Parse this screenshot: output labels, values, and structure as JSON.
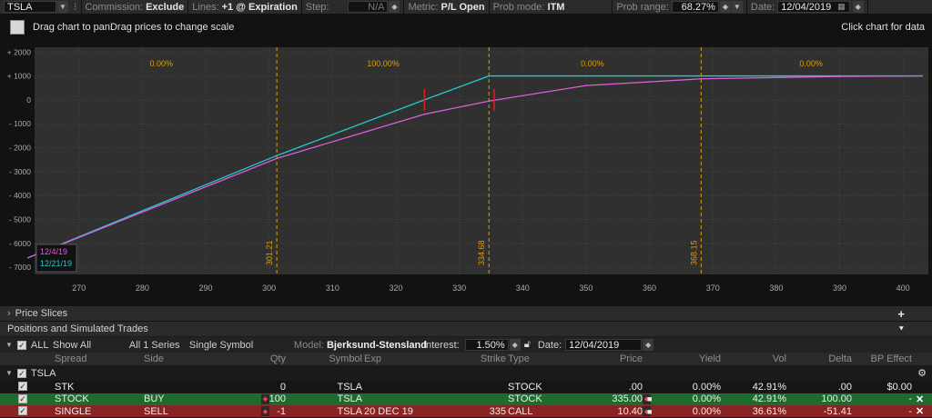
{
  "toolbar": {
    "symbol": "TSLA",
    "commission_label": "Commission:",
    "commission_value": "Exclude",
    "lines_label": "Lines:",
    "lines_value": "+1 @ Expiration",
    "step_label": "Step:",
    "step_value": "N/A",
    "metric_label": "Metric:",
    "metric_value": "P/L Open",
    "prob_mode_label": "Prob mode:",
    "prob_mode_value": "ITM",
    "prob_range_label": "Prob range:",
    "prob_range_value": "68.27%",
    "date_label": "Date:",
    "date_value": "12/04/2019"
  },
  "titlebar": {
    "hint": "Drag chart to panDrag prices to change scale",
    "click_hint": "Click chart for data"
  },
  "chart_data": {
    "type": "line",
    "x": [
      262,
      301.21,
      324.5,
      334.68,
      350,
      368.15,
      390,
      403
    ],
    "series": [
      {
        "name": "12/21/19",
        "color": "#22cccc",
        "values": [
          -6600,
          -2330,
          0,
          1000,
          1000,
          1000,
          1000,
          1000
        ]
      },
      {
        "name": "12/4/19",
        "color": "#d95fd9",
        "values": [
          -6600,
          -2450,
          -600,
          -51,
          600,
          880,
          980,
          1000
        ]
      }
    ],
    "xlim": [
      263,
      404
    ],
    "ylim": [
      -7300,
      2200
    ],
    "x_ticks": [
      270,
      280,
      290,
      300,
      310,
      320,
      330,
      340,
      350,
      360,
      370,
      380,
      390,
      400
    ],
    "y_ticks": [
      2000,
      1000,
      0,
      -1000,
      -2000,
      -3000,
      -4000,
      -5000,
      -6000,
      -7000
    ],
    "y_tick_labels": [
      "+ 2000",
      "+ 1000",
      "0",
      "- 1000",
      "- 2000",
      "- 3000",
      "- 4000",
      "- 5000",
      "- 6000",
      "- 7000"
    ],
    "vlines": [
      {
        "x": 301.21,
        "label": "301.21"
      },
      {
        "x": 334.68,
        "label": "334.68"
      },
      {
        "x": 368.15,
        "label": "368.15"
      }
    ],
    "zone_labels": [
      {
        "x": 283,
        "text": "0.00%"
      },
      {
        "x": 318,
        "text": "100.00%"
      },
      {
        "x": 351,
        "text": "0.00%"
      },
      {
        "x": 385.5,
        "text": "0.00%"
      }
    ],
    "markers": [
      {
        "x": 324.5,
        "y": 0
      },
      {
        "x": 335.5,
        "y": 0
      }
    ],
    "legend": [
      "12/4/19",
      "12/21/19"
    ],
    "grid": true
  },
  "sections": {
    "price_slices": "Price Slices",
    "positions": "Positions and Simulated Trades"
  },
  "filter": {
    "all": "ALL",
    "show_all": "Show All",
    "series": "All 1 Series",
    "single_symbol": "Single Symbol",
    "model_label": "Model:",
    "model_value": "Bjerksund-Stensland",
    "interest_label": "Interest:",
    "interest_value": "1.50%",
    "date_label": "Date:",
    "date_value": "12/04/2019"
  },
  "columns": [
    "Spread",
    "Side",
    "Qty",
    "Symbol",
    "Exp",
    "Strike",
    "Type",
    "Price",
    "Yield",
    "Vol",
    "Delta",
    "BP Effect"
  ],
  "group": {
    "label": "TSLA"
  },
  "rows": [
    {
      "spread": "STK",
      "side": "",
      "qty": "0",
      "symbol": "TSLA",
      "exp": "",
      "strike": "",
      "type": "STOCK",
      "price": ".00",
      "yield": "0.00%",
      "vol": "42.91%",
      "delta": ".00",
      "bp": "$0.00",
      "bg": "#151515"
    },
    {
      "spread": "STOCK",
      "side": "BUY",
      "qty": "+100",
      "symbol": "TSLA",
      "exp": "",
      "strike": "",
      "type": "STOCK",
      "price": "335.00",
      "yield": "0.00%",
      "vol": "42.91%",
      "delta": "100.00",
      "bp": "-",
      "bg": "#1f6b2e"
    },
    {
      "spread": "SINGLE",
      "side": "SELL",
      "qty": "-1",
      "symbol": "TSLA",
      "exp": "20 DEC 19",
      "strike": "335",
      "type": "CALL",
      "price": "10.40",
      "yield": "0.00%",
      "vol": "36.61%",
      "delta": "-51.41",
      "bp": "-",
      "bg": "#8a2424"
    }
  ],
  "colors": {
    "accent": "#e39d00",
    "call_line": "#22cccc",
    "current_line": "#d95fd9",
    "buy_row": "#1f6b2e",
    "sell_row": "#8a2424"
  }
}
